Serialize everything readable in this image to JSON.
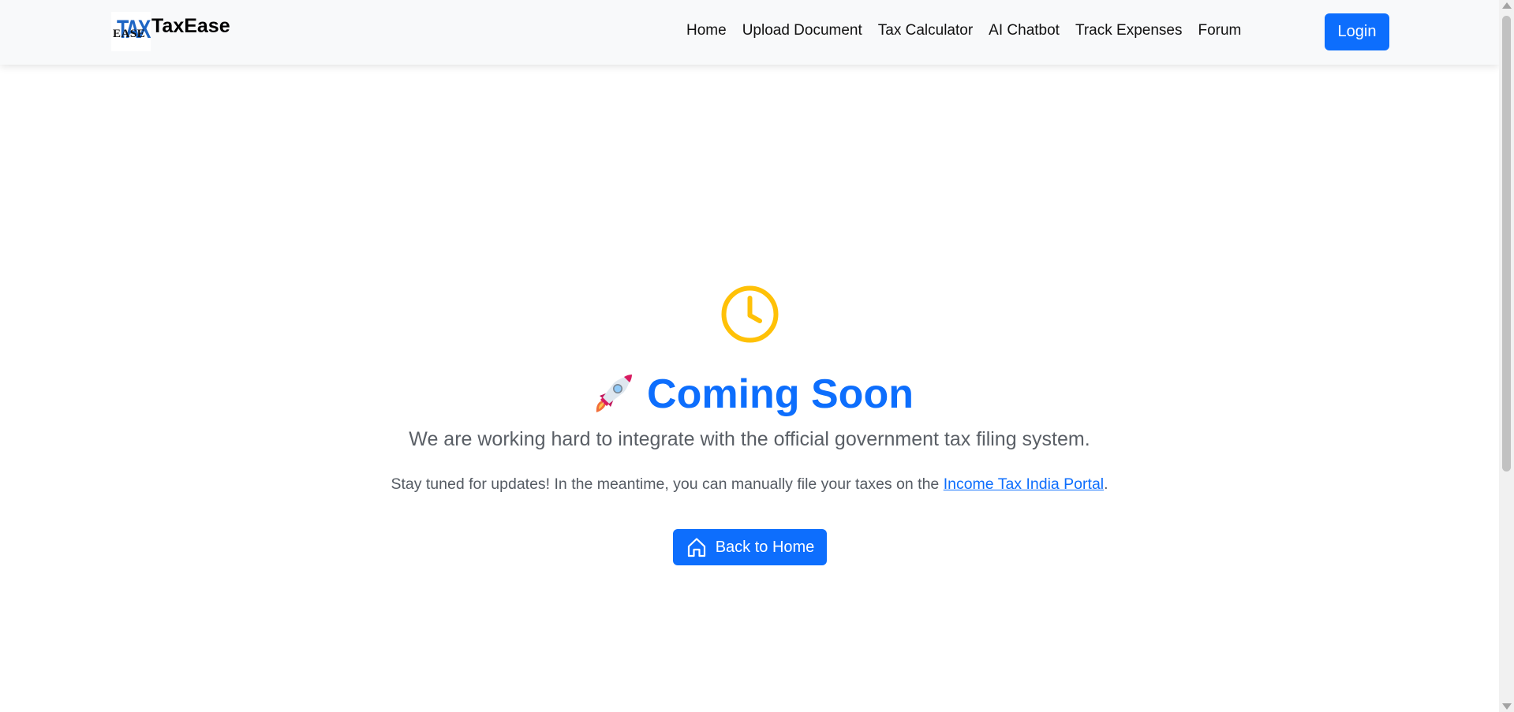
{
  "nav": {
    "logo": {
      "top": "TAX",
      "overlay": "EASE"
    },
    "brand": "TaxEase",
    "links": [
      "Home",
      "Upload Document",
      "Tax Calculator",
      "AI Chatbot",
      "Track Expenses",
      "Forum"
    ],
    "login_label": "Login"
  },
  "main": {
    "icon": "clock-icon",
    "title_icon": "rocket-icon",
    "title": "Coming Soon",
    "lead": "We are working hard to integrate with the official government tax filing system.",
    "note_before": "Stay tuned for updates! In the meantime, you can manually file your taxes on the ",
    "note_link": "Income Tax India Portal",
    "note_after": ".",
    "button_label": "Back to Home",
    "button_icon": "house-icon"
  },
  "colors": {
    "primary": "#0d6efd",
    "clock": "#ffc107",
    "navbar_bg": "#f8f9fa"
  }
}
